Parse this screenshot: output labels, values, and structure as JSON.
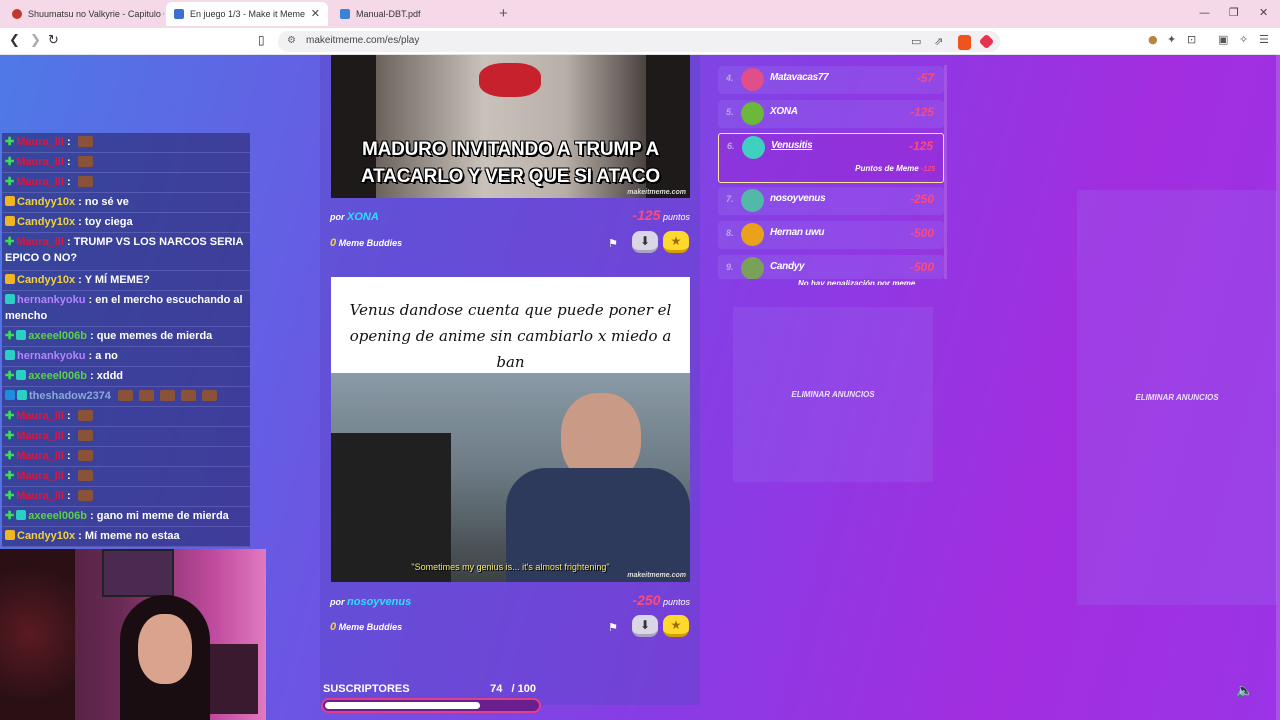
{
  "tabs": [
    {
      "label": "Shuumatsu no Valkyrie - Capitulo 06",
      "icon_color": "#c0392b"
    },
    {
      "label": "En juego 1/3 - Make it Meme",
      "icon_color": "#3b6fd1"
    },
    {
      "label": "Manual-DBT.pdf",
      "icon_color": "#3b82d9"
    }
  ],
  "address_bar": {
    "url": "makeitmeme.com/es/play"
  },
  "memes": [
    {
      "caption": "MADURO INVITANDO A TRUMP A ATACARLO Y VER QUE SI ATACO",
      "watermark": "makeitmeme.com",
      "by_prefix": "por",
      "author": "XONA",
      "points": "-125",
      "points_label": "puntos",
      "buddies_count": "0",
      "buddies_label": "Meme Buddies"
    },
    {
      "caption": "Venus dandose cuenta que puede poner el opening de anime sin cambiarlo x miedo a ban",
      "subtitle": "\"Sometimes my genius is... it's almost frightening\"",
      "watermark": "makeitmeme.com",
      "by_prefix": "por",
      "author": "nosoyvenus",
      "points": "-250",
      "points_label": "puntos",
      "buddies_count": "0",
      "buddies_label": "Meme Buddies"
    }
  ],
  "ranking": [
    {
      "pos": "4.",
      "name": "Matavacas77",
      "points": "-57",
      "avatar_color": "#e14f8a"
    },
    {
      "pos": "5.",
      "name": "XONA",
      "points": "-125",
      "avatar_color": "#6bb83a"
    },
    {
      "pos": "6.",
      "name": "Venusitis",
      "points": "-125",
      "avatar_color": "#3fd0c0",
      "active": true,
      "sub_label": "Puntos de Meme",
      "sub_value": "-125"
    },
    {
      "pos": "7.",
      "name": "nosoyvenus",
      "points": "-250",
      "avatar_color": "#52b8a8"
    },
    {
      "pos": "8.",
      "name": "Hernan uwu",
      "points": "-500",
      "avatar_color": "#e9a21a"
    },
    {
      "pos": "9.",
      "name": "Candyy",
      "points": "-500",
      "avatar_color": "#7aa05a"
    }
  ],
  "ranking_footer": "No hay penalización por meme",
  "ads": {
    "remove_label": "ELIMINAR ANUNCIOS"
  },
  "chat": [
    {
      "badge": "green",
      "user": "Maura_lll",
      "sep": " :",
      "message": "",
      "emotes": 1,
      "user_color": "red"
    },
    {
      "badge": "green",
      "user": "Maura_lll",
      "sep": " :",
      "message": "",
      "emotes": 1,
      "user_color": "red"
    },
    {
      "badge": "green",
      "user": "Maura_lll",
      "sep": " :",
      "message": "",
      "emotes": 1,
      "user_color": "red"
    },
    {
      "badge": "crown",
      "user": "Candyy10x",
      "sep": " :",
      "message": "no sé ve",
      "emotes": 0,
      "user_color": "yellow"
    },
    {
      "badge": "crown",
      "user": "Candyy10x",
      "sep": " :",
      "message": "toy ciega",
      "emotes": 0,
      "user_color": "yellow"
    },
    {
      "badge": "green",
      "user": "Maura_lll",
      "sep": " :",
      "message": "TRUMP VS LOS NARCOS SERIA EPICO O NO?",
      "emotes": 0,
      "user_color": "red"
    },
    {
      "badge": "crown",
      "user": "Candyy10x",
      "sep": " :",
      "message": "Y MÍ MEME?",
      "emotes": 0,
      "user_color": "yellow"
    },
    {
      "badge": "sub",
      "user": "hernankyoku",
      "sep": " :",
      "message": "en el mercho escuchando al mencho",
      "emotes": 0,
      "user_color": "purple"
    },
    {
      "badge": "green-sub",
      "user": "axeeel006b",
      "sep": " :",
      "message": "que memes de mierda",
      "emotes": 0,
      "user_color": "green"
    },
    {
      "badge": "sub",
      "user": "hernankyoku",
      "sep": " :",
      "message": "a no",
      "emotes": 0,
      "user_color": "purple"
    },
    {
      "badge": "green-sub",
      "user": "axeeel006b",
      "sep": " :",
      "message": "xddd",
      "emotes": 0,
      "user_color": "green"
    },
    {
      "badge": "blue-sub",
      "user": "theshadow2374",
      "sep": "",
      "message": "",
      "emotes": 5,
      "user_color": "lblue"
    },
    {
      "badge": "green",
      "user": "Maura_lll",
      "sep": " :",
      "message": "",
      "emotes": 1,
      "user_color": "red"
    },
    {
      "badge": "green",
      "user": "Maura_lll",
      "sep": " :",
      "message": "",
      "emotes": 1,
      "user_color": "red"
    },
    {
      "badge": "green",
      "user": "Maura_lll",
      "sep": " :",
      "message": "",
      "emotes": 1,
      "user_color": "red"
    },
    {
      "badge": "green",
      "user": "Maura_lll",
      "sep": " :",
      "message": "",
      "emotes": 1,
      "user_color": "red"
    },
    {
      "badge": "green",
      "user": "Maura_lll",
      "sep": " :",
      "message": "",
      "emotes": 1,
      "user_color": "red"
    },
    {
      "badge": "green-sub",
      "user": "axeeel006b",
      "sep": " :",
      "message": "gano mi meme de mierda",
      "emotes": 0,
      "user_color": "green"
    },
    {
      "badge": "crown",
      "user": "Candyy10x",
      "sep": " :",
      "message": "Mí meme no estaa",
      "emotes": 0,
      "user_color": "yellow"
    }
  ],
  "subscribers": {
    "label": "SUSCRIPTORES",
    "current": "74",
    "goal": "/ 100",
    "progress": 0.74
  },
  "colors": {
    "accent_pink": "#ff4a7a",
    "accent_cyan": "#2ae0ff",
    "chat_bg": "#28286e"
  }
}
